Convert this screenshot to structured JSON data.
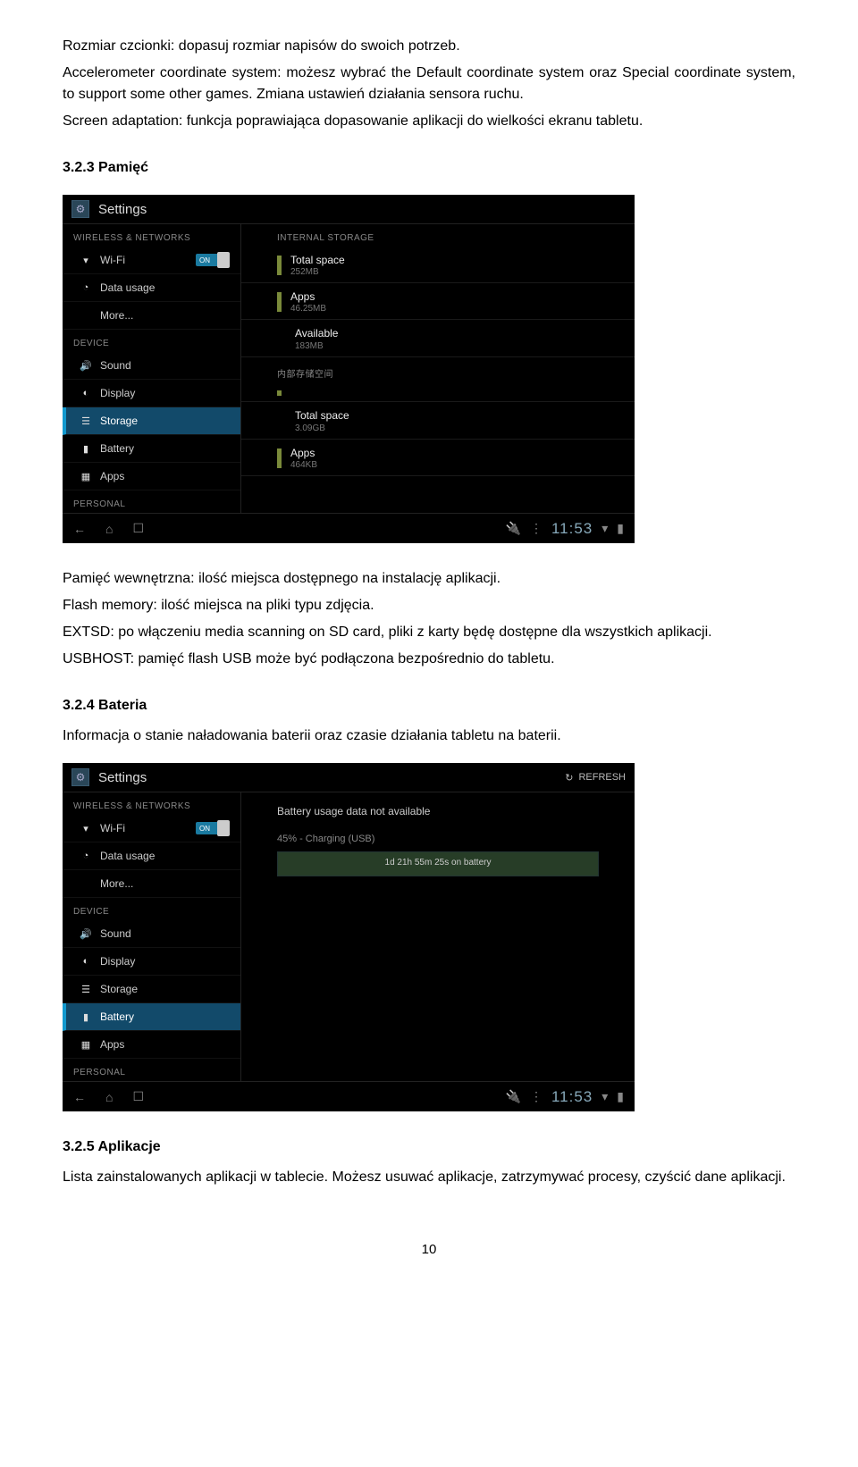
{
  "doc": {
    "p1": "Rozmiar czcionki: dopasuj rozmiar napisów do swoich potrzeb.",
    "p2": "Accelerometer coordinate system: możesz wybrać the Default coordinate system oraz Special coordinate system, to support some other games. Zmiana ustawień działania sensora ruchu.",
    "p3": "Screen adaptation: funkcja poprawiająca dopasowanie aplikacji do wielkości ekranu tabletu.",
    "h1": "3.2.3 Pamięć",
    "p4": "Pamięć wewnętrzna: ilość miejsca dostępnego na instalację aplikacji.",
    "p5": "Flash memory: ilość miejsca na pliki typu zdjęcia.",
    "p6": "EXTSD: po włączeniu media scanning on SD card, pliki z karty będę dostępne dla wszystkich aplikacji.",
    "p7": "USBHOST: pamięć flash USB może być podłączona bezpośrednio do tabletu.",
    "h2": "3.2.4 Bateria",
    "p8": "Informacja o stanie naładowania baterii oraz czasie działania tabletu na baterii.",
    "h3": "3.2.5 Aplikacje",
    "p9": "Lista zainstalowanych aplikacji w tablecie. Możesz usuwać aplikacje, zatrzymywać procesy, czyścić dane aplikacji.",
    "page": "10"
  },
  "sc1": {
    "title": "Settings",
    "sections": {
      "wireless": "WIRELESS & NETWORKS",
      "device": "DEVICE",
      "personal": "PERSONAL"
    },
    "sidebar": {
      "wifi": "Wi-Fi",
      "toggle": "ON",
      "data": "Data usage",
      "more": "More...",
      "sound": "Sound",
      "display": "Display",
      "storage": "Storage",
      "battery": "Battery",
      "apps": "Apps"
    },
    "main": {
      "sec_internal": "INTERNAL STORAGE",
      "total_space": "Total space",
      "total_val": "252MB",
      "apps": "Apps",
      "apps_val": "46.25MB",
      "avail": "Available",
      "avail_val": "183MB",
      "sec_internal2": "内部存储空间",
      "total2": "Total space",
      "total2_val": "3.09GB",
      "apps2": "Apps",
      "apps2_val": "464KB"
    },
    "clock": "11:53"
  },
  "sc2": {
    "title": "Settings",
    "refresh": "REFRESH",
    "sections": {
      "wireless": "WIRELESS & NETWORKS",
      "device": "DEVICE",
      "personal": "PERSONAL"
    },
    "sidebar": {
      "wifi": "Wi-Fi",
      "toggle": "ON",
      "data": "Data usage",
      "more": "More...",
      "sound": "Sound",
      "display": "Display",
      "storage": "Storage",
      "battery": "Battery",
      "apps": "Apps"
    },
    "main": {
      "msg": "Battery usage data not available",
      "status": "45% - Charging (USB)",
      "time": "1d 21h 55m 25s on battery"
    },
    "clock": "11:53"
  }
}
